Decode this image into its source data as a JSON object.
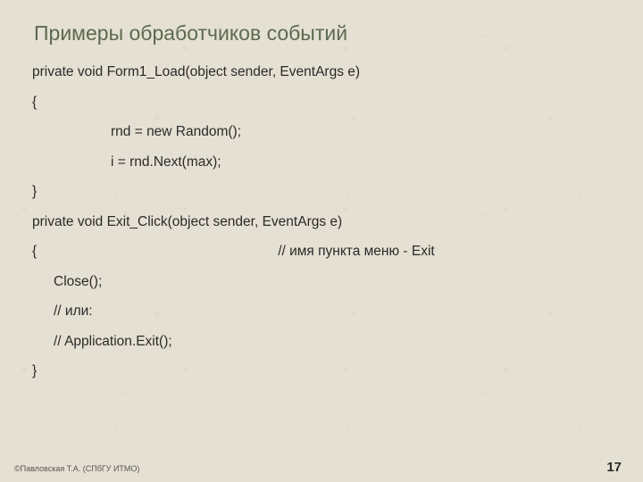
{
  "slide": {
    "title": "Примеры обработчиков событий",
    "code": {
      "l1": "private void Form1_Load(object sender, EventArgs e)",
      "l2": "{",
      "l3": "rnd = new Random();",
      "l4": "i = rnd.Next(max);",
      "l5": "}",
      "l6": "private void Exit_Click(object sender, EventArgs e)",
      "l7a": "{",
      "l7b": "// имя пункта меню - Exit",
      "l8": "Close();",
      "l9": "// или:",
      "l10": "// Application.Exit();",
      "l11": "}"
    },
    "footer_left": "©Павловская Т.А. (СПбГУ ИТМО)",
    "page_number": "17"
  }
}
